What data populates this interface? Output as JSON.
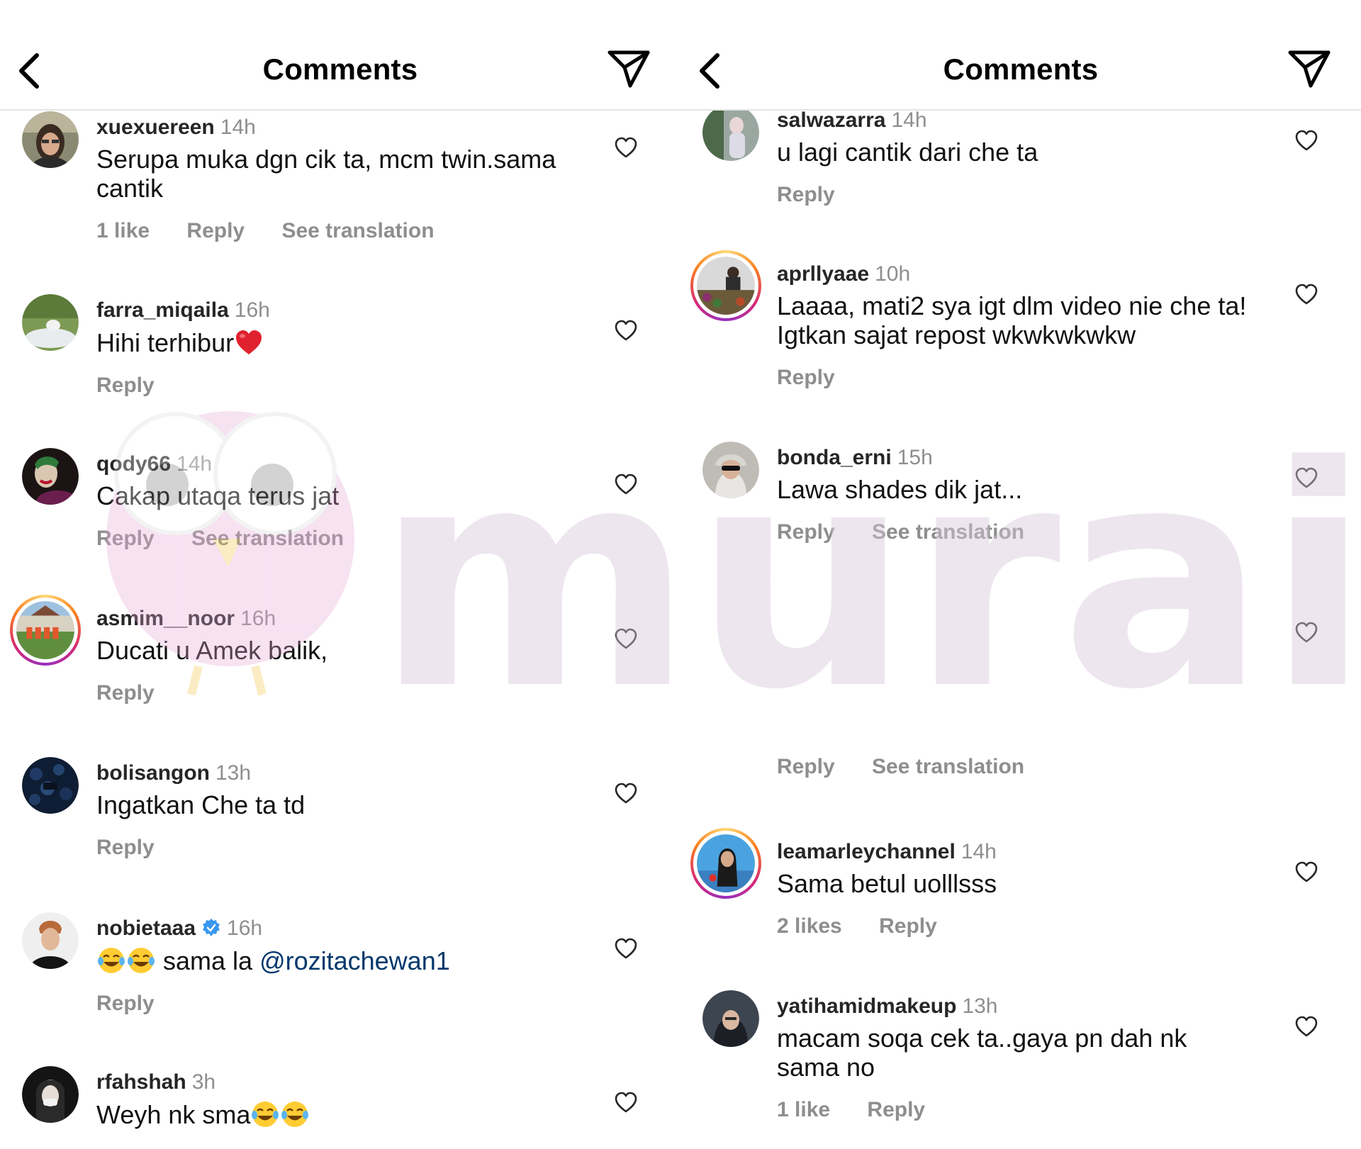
{
  "left": {
    "title": "Comments",
    "comments": [
      {
        "user": "xuexuereen",
        "time": "14h",
        "text": "Serupa muka dgn cik ta, mcm twin.sama cantik",
        "likes": "1 like",
        "reply": "Reply",
        "translation": "See translation"
      },
      {
        "user": "farra_miqaila",
        "time": "16h",
        "text": "Hihi terhibur",
        "reply": "Reply"
      },
      {
        "user": "qody66",
        "time": "14h",
        "text": "Cakap utaqa terus jat",
        "reply": "Reply",
        "translation": "See translation"
      },
      {
        "user": "asmim__noor",
        "time": "16h",
        "text": "Ducati u Amek balik,",
        "reply": "Reply"
      },
      {
        "user": "bolisangon",
        "time": "13h",
        "text": "Ingatkan Che ta td",
        "reply": "Reply"
      },
      {
        "user": "nobietaaa",
        "time": "16h",
        "text": " sama la ",
        "mention": "@rozitachewan1",
        "reply": "Reply"
      },
      {
        "user": "rfahshah",
        "time": "3h",
        "text": "Weyh nk sma"
      }
    ]
  },
  "right": {
    "title": "Comments",
    "comments": [
      {
        "user": "salwazarra",
        "time": "14h",
        "text": "u lagi cantik dari che ta",
        "reply": "Reply"
      },
      {
        "user": "aprllyaae",
        "time": "10h",
        "text": "Laaaa, mati2 sya igt dlm video nie che ta! Igtkan sajat repost wkwkwkwkw",
        "reply": "Reply"
      },
      {
        "user": "bonda_erni",
        "time": "15h",
        "text": "Lawa shades dik jat...",
        "reply": "Reply",
        "translation": "See translation"
      },
      {
        "reply": "Reply",
        "translation": "See translation"
      },
      {
        "user": "leamarleychannel",
        "time": "14h",
        "text": "Sama betul uolllsss",
        "likes": "2 likes",
        "reply": "Reply"
      },
      {
        "user": "yatihamidmakeup",
        "time": "13h",
        "text": "macam soqa cek ta..gaya pn dah nk sama no",
        "likes": "1 like",
        "reply": "Reply"
      }
    ]
  },
  "watermark": {
    "text": "murai"
  },
  "colors": {
    "username": "#262626",
    "meta": "#8e8e8e",
    "mention": "#00376b",
    "verified": "#3897f0",
    "divider": "#e4e4e4"
  }
}
